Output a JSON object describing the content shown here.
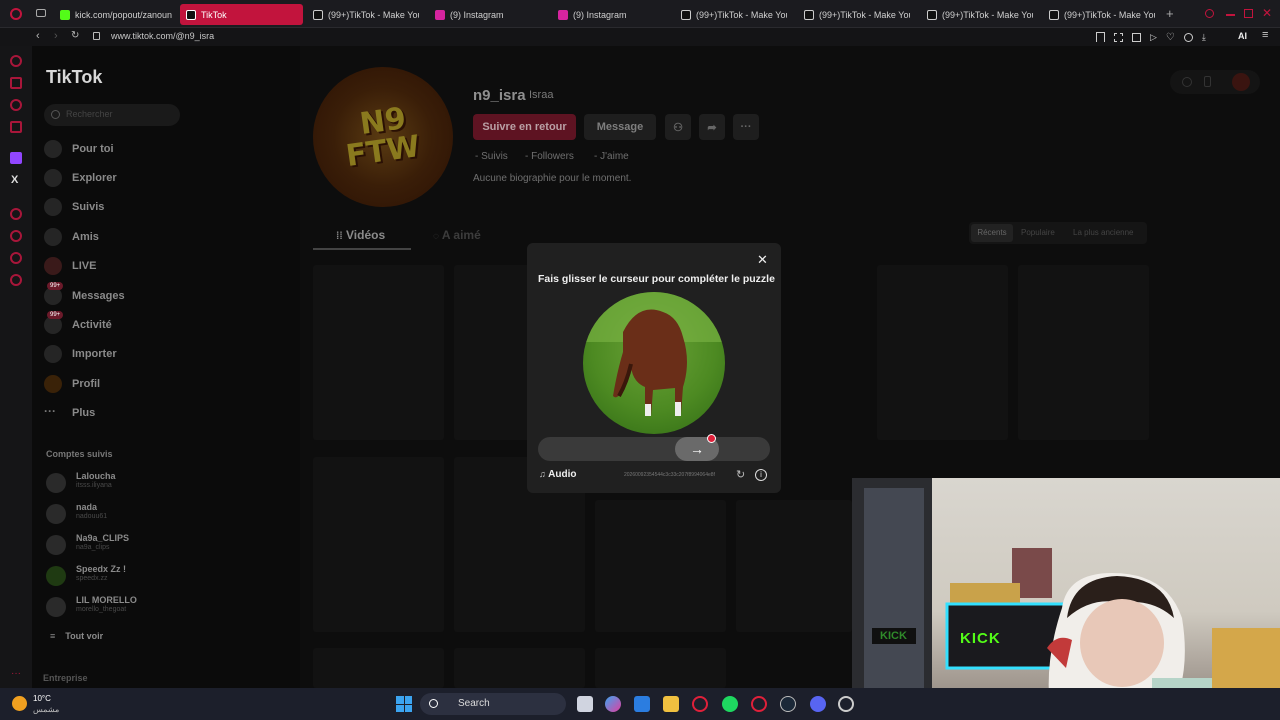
{
  "browser": {
    "tabs": [
      {
        "label": "kick.com/popout/zanoun",
        "color": "#53fc18"
      },
      {
        "label": "TikTok",
        "color": "#111111",
        "active": true
      },
      {
        "label": "(99+)TikTok - Make Your",
        "color": "#111111"
      },
      {
        "label": "(9) Instagram",
        "color": "#d6249f"
      },
      {
        "label": "(9) Instagram",
        "color": "#d6249f"
      },
      {
        "label": "(99+)TikTok - Make Your",
        "color": "#111111"
      },
      {
        "label": "(99+)TikTok - Make Your",
        "color": "#111111"
      },
      {
        "label": "(99+)TikTok - Make Your",
        "color": "#111111"
      },
      {
        "label": "(99+)TikTok - Make Your",
        "color": "#111111"
      }
    ],
    "url": "www.tiktok.com/@n9_isra",
    "ai_label": "AI"
  },
  "sidebar": {
    "logo": "TikTok",
    "search_placeholder": "Rechercher",
    "items": [
      {
        "label": "Pour toi"
      },
      {
        "label": "Explorer"
      },
      {
        "label": "Suivis"
      },
      {
        "label": "Amis"
      },
      {
        "label": "LIVE"
      },
      {
        "label": "Messages",
        "badge": "99+"
      },
      {
        "label": "Activité",
        "badge": "99+"
      },
      {
        "label": "Importer"
      },
      {
        "label": "Profil"
      },
      {
        "label": "Plus"
      }
    ],
    "following_title": "Comptes suivis",
    "accounts": [
      {
        "name": "Laloucha",
        "handle": "itsss.iliyana"
      },
      {
        "name": "nada",
        "handle": "nadouu61"
      },
      {
        "name": "Na9a_CLIPS",
        "handle": "na9a_clips"
      },
      {
        "name": "Speedx Zz !",
        "handle": "speedx.zz"
      },
      {
        "name": "LIL MORELLO",
        "handle": "morello_thegoat"
      }
    ],
    "see_all": "Tout voir",
    "footer": "Entreprise"
  },
  "profile": {
    "avatar_text_1": "N9",
    "avatar_text_2": "FTW",
    "username": "n9_isra",
    "nickname": "Israa",
    "follow_back": "Suivre en retour",
    "message": "Message",
    "stats": [
      {
        "value": "-",
        "label": "Suivis"
      },
      {
        "value": "-",
        "label": "Followers"
      },
      {
        "value": "-",
        "label": "J'aime"
      }
    ],
    "bio": "Aucune biographie pour le moment.",
    "tabs": [
      "Vidéos",
      "A aimé"
    ],
    "sort": [
      "Récents",
      "Populaire",
      "La plus ancienne"
    ]
  },
  "captcha": {
    "title": "Fais glisser le curseur pour compléter le puzzle",
    "audio": "Audio",
    "id_text": "20260092354544c3c33c207f8994064e8f",
    "slider_progress": 0.73
  },
  "taskbar": {
    "weather_temp": "10°C",
    "weather_desc": "مشمس",
    "search": "Search"
  },
  "webcam": {
    "sign_1": "KICK",
    "sign_2": "KICK"
  }
}
